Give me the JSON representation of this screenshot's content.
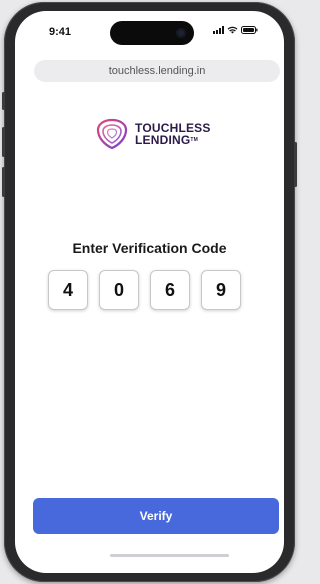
{
  "status_bar": {
    "time": "9:41"
  },
  "browser": {
    "url": "touchless.lending.in"
  },
  "brand": {
    "line1": "TOUCHLESS",
    "line2": "LENDING",
    "trademark": "TM"
  },
  "verification": {
    "title": "Enter Verification Code",
    "digits": [
      "4",
      "0",
      "6",
      "9"
    ]
  },
  "actions": {
    "verify_label": "Verify"
  },
  "colors": {
    "accent": "#4769dc",
    "brand_dark": "#2b1a4a",
    "logo_pink": "#e0467a",
    "logo_purple": "#7a3fd0"
  }
}
